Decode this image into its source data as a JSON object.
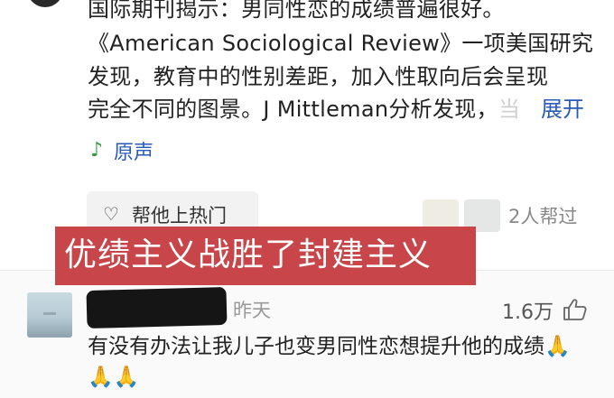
{
  "post": {
    "lines": [
      "国际期刊揭示：男同性恋的成绩普遍很好。",
      "《American Sociological Review》一项美国研究",
      "发现，教育中的性别差距，加入性取向后会呈现",
      "完全不同的图景。J Mittleman分析发现，"
    ],
    "trailing_char": "当",
    "expand_label": "展开",
    "audio_label": "原声"
  },
  "actions": {
    "help_label": "帮他上热门",
    "helped_text": "2人帮过"
  },
  "banner": {
    "text": "优绩主义战胜了封建主义"
  },
  "comment": {
    "time": "昨天",
    "likes": "1.6万",
    "text": "有没有办法让我儿子也变男同性恋想提升他的成绩",
    "emoji": "🙏🙏🙏"
  },
  "icons": {
    "audio": "music-note-icon",
    "help": "heart-hands-icon",
    "like": "thumbs-up-icon"
  },
  "colors": {
    "link": "#2a5bb8",
    "banner": "#c8464a",
    "audio_icon": "#3a9a4a"
  }
}
